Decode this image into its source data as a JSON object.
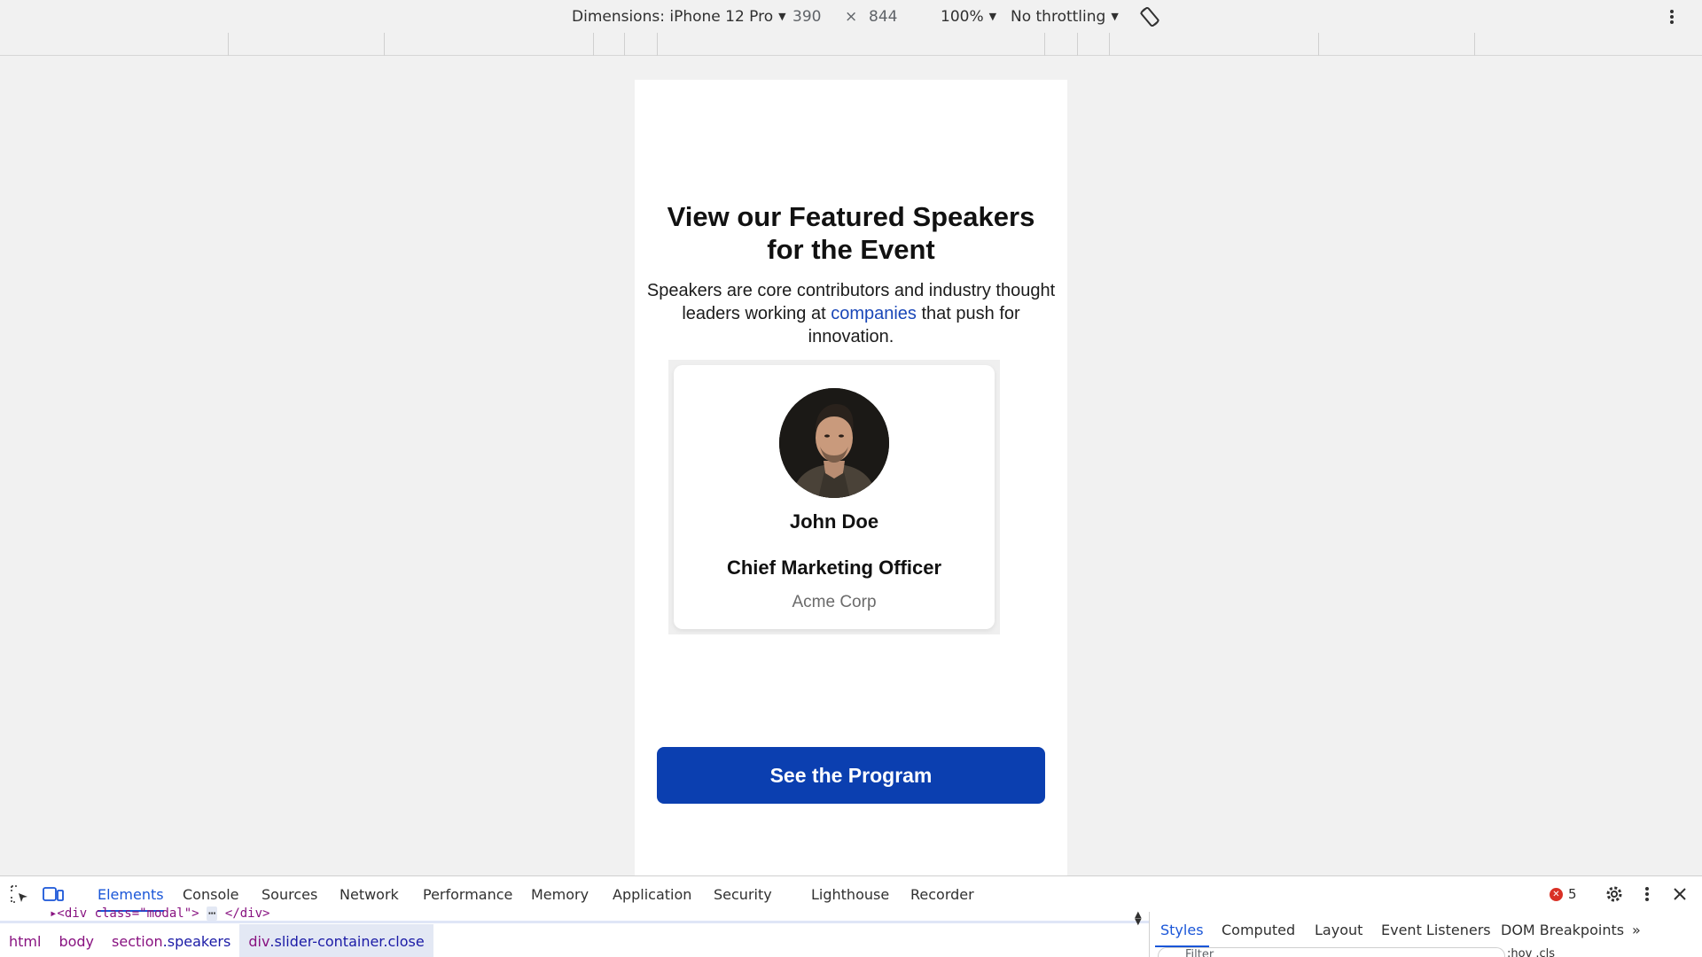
{
  "device_toolbar": {
    "dimensions_label": "Dimensions: iPhone 12 Pro",
    "width": "390",
    "times": "×",
    "height": "844",
    "zoom": "100%",
    "throttling": "No throttling"
  },
  "page": {
    "title": "View our Featured Speakers for the Event",
    "description_before": "Speakers are core contributors and industry thought leaders working at ",
    "description_link": "companies",
    "description_after": " that push for innovation.",
    "speaker": {
      "name": "John Doe",
      "role": "Chief Marketing Officer",
      "company": "Acme Corp"
    },
    "cta_label": "See the Program"
  },
  "devtools": {
    "tabs": [
      "Elements",
      "Console",
      "Sources",
      "Network",
      "Performance",
      "Memory",
      "Application",
      "Security",
      "Lighthouse",
      "Recorder"
    ],
    "active_tab": "Elements",
    "error_count": "5",
    "dom_snippet_start": "▸<div class=\"modal\">",
    "dom_snippet_ellipsis": "⋯",
    "dom_snippet_end": "</div>",
    "breadcrumbs": {
      "html": "html",
      "body": "body",
      "speakers_tag": "section",
      "speakers_class": ".speakers",
      "slider_tag": "div",
      "slider_class": ".slider-container.close"
    },
    "side_tabs": [
      "Styles",
      "Computed",
      "Layout",
      "Event Listeners",
      "DOM Breakpoints"
    ],
    "active_side_tab": "Styles",
    "filter_placeholder": "Filter",
    "side_tools": ":hov .cls"
  },
  "colors": {
    "accent": "#0b3fb0",
    "link": "#1a47b8",
    "devtools_active": "#1a56d8",
    "error": "#d93025"
  }
}
